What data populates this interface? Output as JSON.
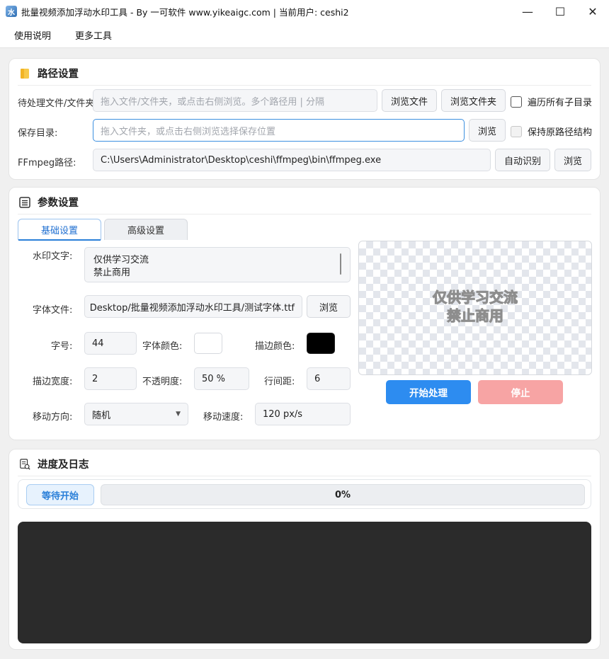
{
  "window": {
    "title": "批量视频添加浮动水印工具 - By 一可软件 www.yikeaigc.com | 当前用户: ceshi2",
    "controls": {
      "minimize": "—",
      "maximize": "☐",
      "close": "✕"
    }
  },
  "menu": {
    "items": [
      "使用说明",
      "更多工具"
    ]
  },
  "path_settings": {
    "title": "路径设置",
    "source_label": "待处理文件/文件夹:",
    "source_placeholder": "拖入文件/文件夹，或点击右侧浏览。多个路径用 | 分隔",
    "browse_file": "浏览文件",
    "browse_folder": "浏览文件夹",
    "recurse_label": "遍历所有子目录",
    "save_label": "保存目录:",
    "save_placeholder": "拖入文件夹，或点击右侧浏览选择保存位置",
    "save_browse": "浏览",
    "keep_structure_label": "保持原路径结构",
    "ffmpeg_label": "FFmpeg路径:",
    "ffmpeg_value": "C:\\Users\\Administrator\\Desktop\\ceshi\\ffmpeg\\bin\\ffmpeg.exe",
    "auto_detect": "自动识别",
    "ffmpeg_browse": "浏览"
  },
  "params": {
    "title": "参数设置",
    "tabs": [
      "基础设置",
      "高级设置"
    ],
    "watermark_label": "水印文字:",
    "watermark_lines": [
      "仅供学习交流",
      "禁止商用"
    ],
    "font_label": "字体文件:",
    "font_value": "Desktop/批量视频添加浮动水印工具/测试字体.ttf",
    "font_browse": "浏览",
    "size_label": "字号:",
    "size_value": "44",
    "font_color_label": "字体颜色:",
    "font_color": "#ffffff",
    "stroke_color_label": "描边颜色:",
    "stroke_color": "#000000",
    "stroke_width_label": "描边宽度:",
    "stroke_width_value": "2",
    "opacity_label": "不透明度:",
    "opacity_value": "50 %",
    "line_spacing_label": "行间距:",
    "line_spacing_value": "6",
    "direction_label": "移动方向:",
    "direction_value": "随机",
    "speed_label": "移动速度:",
    "speed_value": "120 px/s",
    "preview_lines": [
      "仅供学习交流",
      "禁止商用"
    ],
    "start_button": "开始处理",
    "stop_button": "停止"
  },
  "progress": {
    "title": "进度及日志",
    "status": "等待开始",
    "percent": 0,
    "percent_text": "0%"
  },
  "colors": {
    "accent": "#2a7fd8",
    "primary_button": "#2d8cf0",
    "stop_button": "#f7a4a4",
    "log_bg": "#2b2b2b"
  }
}
